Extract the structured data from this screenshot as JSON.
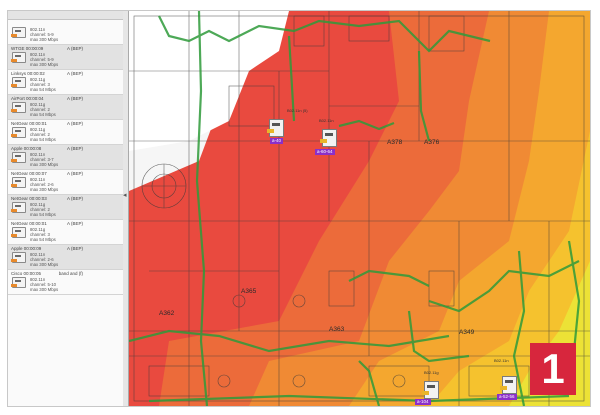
{
  "accent": "#d7263d",
  "panel_number": "1",
  "sidebar": {
    "items": [
      {
        "label": "",
        "flag": "",
        "lines": [
          "802.11n",
          "channel: 5-9",
          "max 300 Mbps"
        ]
      },
      {
        "label": "WTGE 00:00:09",
        "flag": "A (BEP)",
        "lines": [
          "802.11n",
          "channel: 5-9",
          "max 300 Mbps"
        ]
      },
      {
        "label": "Linksys 00:00:02",
        "flag": "A (BEP)",
        "lines": [
          "802.11g",
          "channel: 3",
          "max 54 Mbps"
        ]
      },
      {
        "label": "AirPort 00:00:04",
        "flag": "A (BEP)",
        "lines": [
          "802.11g",
          "channel: 2",
          "max 54 Mbps"
        ]
      },
      {
        "label": "NetGear 00:00:01",
        "flag": "A (BEP)",
        "lines": [
          "802.11g",
          "channel: 2",
          "max 54 Mbps"
        ]
      },
      {
        "label": "Apple 00:00:08",
        "flag": "A (BEP)",
        "lines": [
          "802.11n",
          "channel: 3-7",
          "max 300 Mbps"
        ]
      },
      {
        "label": "NetGear 00:00:07",
        "flag": "A (BEP)",
        "lines": [
          "802.11n",
          "channel: 2-6",
          "max 300 Mbps"
        ]
      },
      {
        "label": "NetGear 00:00:03",
        "flag": "A (BEP)",
        "lines": [
          "802.11g",
          "channel: 2",
          "max 54 Mbps"
        ]
      },
      {
        "label": "NetGear 00:00:01",
        "flag": "A (BEP)",
        "lines": [
          "802.11g",
          "channel: 3",
          "max 54 Mbps"
        ]
      },
      {
        "label": "Apple 00:00:09",
        "flag": "A (BEP)",
        "lines": [
          "802.11n",
          "channel: 2-6",
          "max 300 Mbps"
        ]
      },
      {
        "label": "Cisco 00:00:05",
        "flag": "band and (f)",
        "lines": [
          "802.11n",
          "channel: 5-10",
          "max 300 Mbps"
        ]
      }
    ]
  },
  "map": {
    "rooms": [
      "A378",
      "A376",
      "A365",
      "A362",
      "A363",
      "A349"
    ],
    "aps": [
      {
        "chip": "a-40",
        "lines": [
          "B02.11n (5)",
          "ch 5-9"
        ]
      },
      {
        "chip": "a-60-64",
        "lines": [
          "B02.11n",
          "ch (BP+2)"
        ]
      },
      {
        "chip": "a-104",
        "lines": [
          "B02.11g",
          "ch 2"
        ]
      },
      {
        "chip": "a-52-56",
        "lines": [
          "B02.11n",
          "ch (BP+2)"
        ]
      }
    ]
  }
}
